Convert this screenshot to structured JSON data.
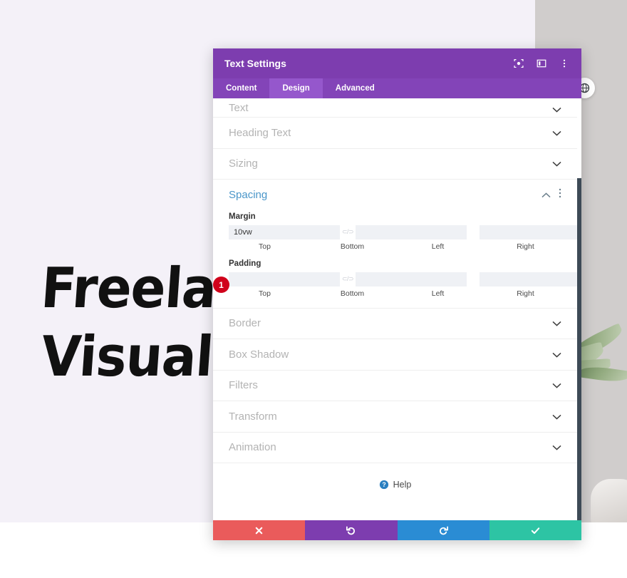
{
  "background": {
    "hero_line1": "Freelan",
    "hero_line2": "Visual A",
    "canvas_bg": "#f4f1f8",
    "photo_bg": "#d0cdcc"
  },
  "floating_button": {
    "icon": "globe-icon"
  },
  "modal": {
    "title": "Text Settings",
    "header_icons": [
      {
        "name": "focus-target-icon"
      },
      {
        "name": "layout-columns-icon"
      },
      {
        "name": "vertical-dots-icon"
      }
    ],
    "tabs": [
      {
        "label": "Content",
        "active": false
      },
      {
        "label": "Design",
        "active": true
      },
      {
        "label": "Advanced",
        "active": false
      }
    ],
    "sections_above": [
      {
        "label": "Text",
        "state": "collapsed",
        "partial": true
      },
      {
        "label": "Heading Text",
        "state": "collapsed",
        "partial": false
      },
      {
        "label": "Sizing",
        "state": "collapsed",
        "partial": false
      }
    ],
    "spacing": {
      "label": "Spacing",
      "state": "expanded",
      "accent_color": "#4a96c9",
      "collapse_icon": "chevron-up-icon",
      "menu_icon": "vertical-dots-icon",
      "badge": "1",
      "groups": [
        {
          "title": "Margin",
          "fields": [
            {
              "label": "Top",
              "value": "10vw",
              "placeholder": ""
            },
            {
              "label": "Bottom",
              "value": "",
              "placeholder": ""
            },
            {
              "label": "Left",
              "value": "",
              "placeholder": ""
            },
            {
              "label": "Right",
              "value": "",
              "placeholder": ""
            }
          ],
          "link_icon": "broken-link-icon"
        },
        {
          "title": "Padding",
          "fields": [
            {
              "label": "Top",
              "value": "",
              "placeholder": ""
            },
            {
              "label": "Bottom",
              "value": "",
              "placeholder": ""
            },
            {
              "label": "Left",
              "value": "",
              "placeholder": ""
            },
            {
              "label": "Right",
              "value": "",
              "placeholder": ""
            }
          ],
          "link_icon": "broken-link-icon"
        }
      ]
    },
    "sections_below": [
      {
        "label": "Border",
        "state": "collapsed"
      },
      {
        "label": "Box Shadow",
        "state": "collapsed"
      },
      {
        "label": "Filters",
        "state": "collapsed"
      },
      {
        "label": "Transform",
        "state": "collapsed"
      },
      {
        "label": "Animation",
        "state": "collapsed"
      }
    ],
    "help": {
      "label": "Help",
      "icon": "question-circle-icon"
    },
    "footer_buttons": [
      {
        "name": "cancel-button",
        "icon": "close-icon",
        "color": "#ea5b5b"
      },
      {
        "name": "undo-button",
        "icon": "undo-icon",
        "color": "#7d3daf"
      },
      {
        "name": "redo-button",
        "icon": "redo-icon",
        "color": "#2a8cd4"
      },
      {
        "name": "save-button",
        "icon": "checkmark-icon",
        "color": "#2dc4a4"
      }
    ],
    "header_color": "#7d3daf",
    "tabbar_color": "#8344b8",
    "tab_active_color": "#9557cc"
  }
}
